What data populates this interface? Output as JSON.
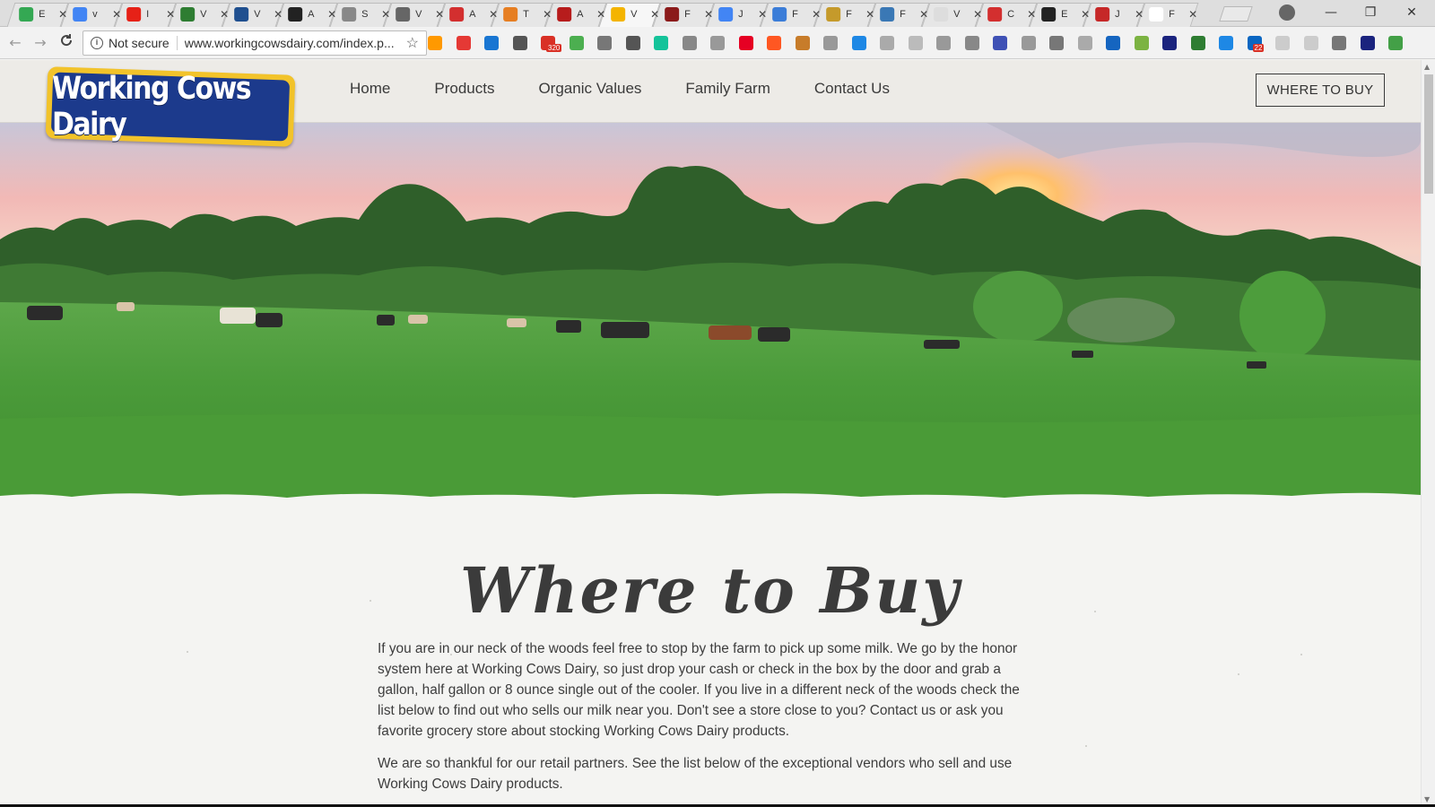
{
  "browser": {
    "tabs": [
      {
        "title": "E",
        "favicon": "google-maps-icon",
        "color": "#34a853"
      },
      {
        "title": "v",
        "favicon": "google-icon",
        "color": "#4285f4"
      },
      {
        "title": "I",
        "favicon": "youtube-icon",
        "color": "#e62117"
      },
      {
        "title": "V",
        "favicon": "green-square-icon",
        "color": "#2e7d32"
      },
      {
        "title": "V",
        "favicon": "blue-circle-icon",
        "color": "#1f4f8f"
      },
      {
        "title": "A",
        "favicon": "ali-icon",
        "color": "#222222"
      },
      {
        "title": "S",
        "favicon": "document-icon",
        "color": "#888888"
      },
      {
        "title": "V",
        "favicon": "circle-icon",
        "color": "#666666"
      },
      {
        "title": "A",
        "favicon": "red-a-icon",
        "color": "#d32f2f"
      },
      {
        "title": "T",
        "favicon": "orange-circle-icon",
        "color": "#e67e22"
      },
      {
        "title": "A",
        "favicon": "red-shield-icon",
        "color": "#b71c1c"
      },
      {
        "title": "V",
        "favicon": "pinwheel-icon",
        "color": "#f4b400",
        "active": true
      },
      {
        "title": "F",
        "favicon": "maroon-square-icon",
        "color": "#8b1a1a"
      },
      {
        "title": "J",
        "favicon": "google-icon",
        "color": "#4285f4"
      },
      {
        "title": "F",
        "favicon": "dot-icon",
        "color": "#3b7dd8"
      },
      {
        "title": "F",
        "favicon": "coin-icon",
        "color": "#c59a2b"
      },
      {
        "title": "F",
        "favicon": "cloud-icon",
        "color": "#3a78b5"
      },
      {
        "title": "V",
        "favicon": "blank-icon",
        "color": "#dddddd"
      },
      {
        "title": "C",
        "favicon": "red-12-icon",
        "color": "#d32f2f"
      },
      {
        "title": "E",
        "favicon": "ali-icon",
        "color": "#222222"
      },
      {
        "title": "J",
        "favicon": "red-pattern-icon",
        "color": "#c62828"
      },
      {
        "title": "F",
        "favicon": "wikipedia-icon",
        "color": "#ffffff"
      }
    ],
    "window_controls": {
      "minimize": "—",
      "maximize": "❐",
      "close": "✕"
    },
    "toolbar": {
      "back": "←",
      "forward": "→",
      "reload": "C",
      "security_text": "Not secure",
      "url": "www.workingcowsdairy.com/index.p...",
      "info_glyph": "i",
      "star_glyph": "☆"
    },
    "extensions": [
      {
        "name": "amazon-icon",
        "color": "#ff9900"
      },
      {
        "name": "magnet-icon",
        "color": "#e53935"
      },
      {
        "name": "vimeo-icon",
        "color": "#1976d2"
      },
      {
        "name": "eyedropper-icon",
        "color": "#555555"
      },
      {
        "name": "gmail-icon",
        "color": "#d93025",
        "badge": "320"
      },
      {
        "name": "shield-icon",
        "color": "#4caf50"
      },
      {
        "name": "signal-icon",
        "color": "#777777"
      },
      {
        "name": "gear-icon",
        "color": "#555555"
      },
      {
        "name": "grammarly-icon",
        "color": "#15c39a"
      },
      {
        "name": "puzzle-icon",
        "color": "#888888"
      },
      {
        "name": "cast-icon",
        "color": "#999999"
      },
      {
        "name": "pinterest-icon",
        "color": "#e60023"
      },
      {
        "name": "plus-icon",
        "color": "#ff5722"
      },
      {
        "name": "hammer-icon",
        "color": "#c77c2a"
      },
      {
        "name": "grid-icon",
        "color": "#999999"
      },
      {
        "name": "search-icon",
        "color": "#1e88e5"
      },
      {
        "name": "window-icon",
        "color": "#aaaaaa"
      },
      {
        "name": "x-box-icon",
        "color": "#bbbbbb"
      },
      {
        "name": "c-icon",
        "color": "#999999"
      },
      {
        "name": "reader-icon",
        "color": "#888888"
      },
      {
        "name": "color-grid-icon",
        "color": "#3f51b5"
      },
      {
        "name": "tag-icon",
        "color": "#999999"
      },
      {
        "name": "s-icon",
        "color": "#777777"
      },
      {
        "name": "shield-gray-icon",
        "color": "#aaaaaa"
      },
      {
        "name": "bookmark-icon",
        "color": "#1565c0"
      },
      {
        "name": "sprout-icon",
        "color": "#7cb342"
      },
      {
        "name": "e-circle-icon",
        "color": "#1a237e"
      },
      {
        "name": "bw-icon",
        "color": "#2e7d32"
      },
      {
        "name": "wave-icon",
        "color": "#1e88e5"
      },
      {
        "name": "linkedin-icon",
        "color": "#0a66c2",
        "badge": "22"
      },
      {
        "name": "dotted-box-icon",
        "color": "#cccccc"
      },
      {
        "name": "flower-icon",
        "color": "#cccccc"
      },
      {
        "name": "power-icon",
        "color": "#777777"
      },
      {
        "name": "n-icon",
        "color": "#1a237e"
      },
      {
        "name": "up-arrow-icon",
        "color": "#43a047"
      }
    ]
  },
  "site": {
    "logo_text": "Working Cows Dairy",
    "nav": [
      "Home",
      "Products",
      "Organic Values",
      "Family Farm",
      "Contact Us"
    ],
    "cta": "WHERE TO BUY",
    "hero_alt": "cow-pasture-hero-image",
    "title": "Where to Buy",
    "paragraphs": [
      "If you are in our neck of the woods feel free to stop by the farm to pick up some milk. We go by the honor system here at Working Cows Dairy, so just drop your cash or check in the box by the door and grab a gallon, half gallon or 8 ounce single out of the cooler. If you live in a different neck of the woods check the list below to find out who sells our milk near you. Don't see a store close to you? Contact us or ask you favorite grocery store about stocking Working Cows Dairy products.",
      "We are so thankful for our retail partners. See the list below of the exceptional vendors who sell and use Working Cows Dairy products."
    ]
  },
  "colors": {
    "logo_blue": "#1c3a8c",
    "logo_yellow": "#f2c32a",
    "header_bg": "#edebe7",
    "body_bg": "#f4f4f2",
    "text": "#3d3d3d"
  }
}
